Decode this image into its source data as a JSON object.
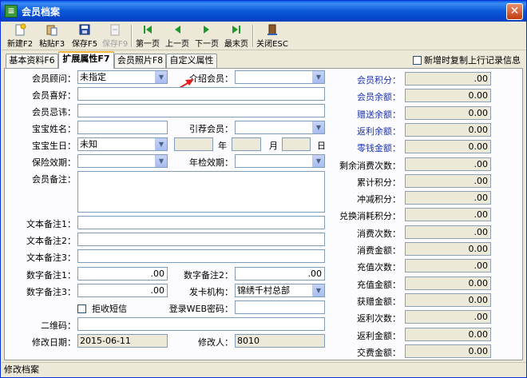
{
  "window": {
    "title": "会员档案",
    "close": "✕"
  },
  "toolbar": {
    "new": "新建F2",
    "paste": "粘贴F3",
    "save": "保存F5",
    "unsave": "保存F9",
    "first": "第一页",
    "prev": "上一页",
    "next": "下一页",
    "last": "最末页",
    "close": "关闭ESC"
  },
  "tabs": [
    "基本资料F6",
    "扩展属性F7",
    "会员照片F8",
    "自定义属性"
  ],
  "copy_option": "新增时复制上行记录信息",
  "form": {
    "advisor_label": "会员顾问：",
    "advisor_value": "未指定",
    "referrer_label": "介绍会员：",
    "hobby_label": "会员喜好：",
    "taboo_label": "会员忌讳：",
    "baby_name_label": "宝宝姓名：",
    "guide_member_label": "引荐会员：",
    "baby_birthday_label": "宝宝生日：",
    "baby_birthday_value": "未知",
    "year": "年",
    "month": "月",
    "day": "日",
    "insurance_label": "保险效期：",
    "inspection_label": "年检效期：",
    "remark_label": "会员备注：",
    "text1_label": "文本备注1：",
    "text2_label": "文本备注2：",
    "text3_label": "文本备注3：",
    "num1_label": "数字备注1：",
    "num1_value": ".00",
    "num2_label": "数字备注2：",
    "num2_value": ".00",
    "num3_label": "数字备注3：",
    "num3_value": ".00",
    "card_org_label": "发卡机构：",
    "card_org_value": "锦绣千村总部",
    "reject_sms": "拒收短信",
    "web_pwd_label": "登录WEB密码：",
    "qrcode_label": "二维码：",
    "modify_date_label": "修改日期：",
    "modify_date_value": "2015-06-11",
    "modifier_label": "修改人：",
    "modifier_value": "8010"
  },
  "stats": [
    {
      "label": "会员积分：",
      "value": ".00",
      "color": "#1d32b0"
    },
    {
      "label": "会员余额：",
      "value": "0.00",
      "color": "#1d32b0"
    },
    {
      "label": "赠送余额：",
      "value": "0.00",
      "color": "#1d32b0"
    },
    {
      "label": "返利余额：",
      "value": "0.00",
      "color": "#1d32b0"
    },
    {
      "label": "零钱金额：",
      "value": "0.00",
      "color": "#1d32b0"
    },
    {
      "label": "剩余消费次数：",
      "value": ".00",
      "color": "#000000"
    },
    {
      "label": "累计积分：",
      "value": ".00",
      "color": "#000000"
    },
    {
      "label": "冲减积分：",
      "value": ".00",
      "color": "#000000"
    },
    {
      "label": "兑换消耗积分：",
      "value": ".00",
      "color": "#000000"
    },
    {
      "label": "消费次数：",
      "value": ".00",
      "color": "#000000"
    },
    {
      "label": "消费金额：",
      "value": "0.00",
      "color": "#000000"
    },
    {
      "label": "充值次数：",
      "value": ".00",
      "color": "#000000"
    },
    {
      "label": "充值金额：",
      "value": "0.00",
      "color": "#000000"
    },
    {
      "label": "获赠金额：",
      "value": "0.00",
      "color": "#000000"
    },
    {
      "label": "返利次数：",
      "value": ".00",
      "color": "#000000"
    },
    {
      "label": "返利金额：",
      "value": "0.00",
      "color": "#000000"
    },
    {
      "label": "交费金额：",
      "value": "0.00",
      "color": "#000000"
    }
  ],
  "status_text": "修改档案"
}
